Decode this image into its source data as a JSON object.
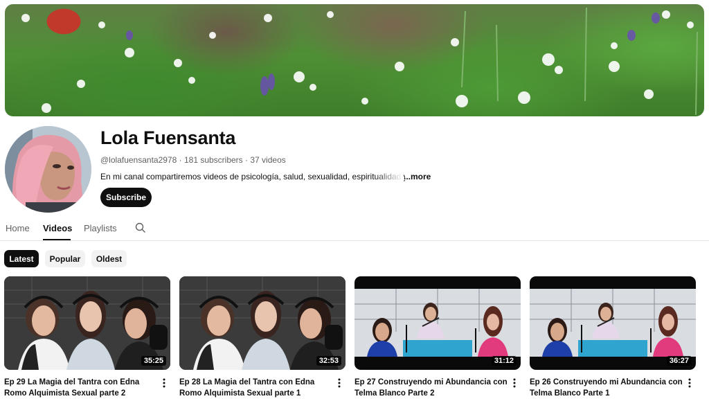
{
  "channel": {
    "name": "Lola Fuensanta",
    "handle": "@lolafuensanta2978",
    "subscribers": "181 subscribers",
    "videos_count": "37 videos",
    "separator": "·",
    "description": "En mi canal compartiremos videos de psicología, salud, sexualidad, espiritualidad y cuál",
    "more_label": "...more",
    "subscribe_label": "Subscribe"
  },
  "tabs": [
    {
      "label": "Home",
      "active": false
    },
    {
      "label": "Videos",
      "active": true
    },
    {
      "label": "Playlists",
      "active": false
    }
  ],
  "chips": [
    {
      "label": "Latest",
      "active": true
    },
    {
      "label": "Popular",
      "active": false
    },
    {
      "label": "Oldest",
      "active": false
    }
  ],
  "videos": [
    {
      "title": "Ep 29 La Magia del Tantra con Edna Romo Alquimista Sexual parte 2",
      "duration": "35:25",
      "thumb_style": "studio"
    },
    {
      "title": "Ep 28 La Magia del Tantra con Edna Romo Alquimista Sexual parte 1",
      "duration": "32:53",
      "thumb_style": "studio"
    },
    {
      "title": "Ep 27 Construyendo mi Abundancia con Telma Blanco Parte 2",
      "duration": "31:12",
      "thumb_style": "podcast"
    },
    {
      "title": "Ep 26 Construyendo mi Abundancia con Telma Blanco Parte 1",
      "duration": "36:27",
      "thumb_style": "podcast"
    }
  ],
  "colors": {
    "text": "#0f0f0f",
    "secondary": "#606060",
    "chip_bg": "#f2f2f2"
  },
  "icons": {
    "search": "search-icon",
    "menu": "more-vert-icon"
  }
}
